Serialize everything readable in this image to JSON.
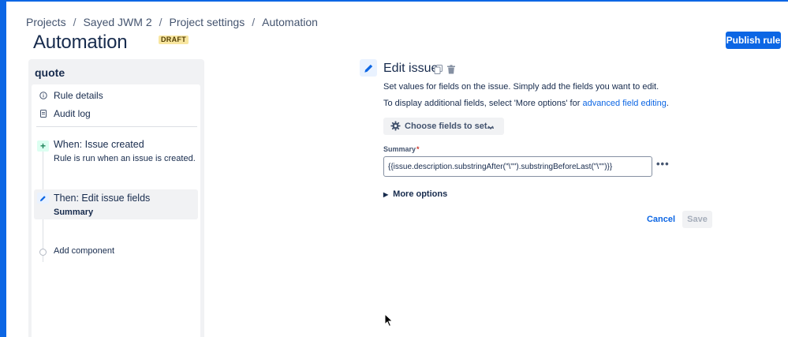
{
  "breadcrumb": [
    "Projects",
    "Sayed JWM 2",
    "Project settings",
    "Automation"
  ],
  "breadcrumb_separator": "/",
  "page": {
    "title": "Automation",
    "badge": "DRAFT"
  },
  "header": {
    "publish_label": "Publish rule"
  },
  "rule": {
    "name": "quote",
    "nav": {
      "details_label": "Rule details",
      "audit_label": "Audit log"
    },
    "trigger": {
      "title": "When: Issue created",
      "description": "Rule is run when an issue is created.",
      "icon_glyph": "+"
    },
    "action": {
      "title": "Then: Edit issue fields",
      "subtitle": "Summary"
    },
    "add_label": "Add component"
  },
  "editor": {
    "title": "Edit issue",
    "description": "Set values for fields on the issue. Simply add the fields you want to edit.",
    "additional_prefix": "To display additional fields, select 'More options' for ",
    "additional_link": "advanced field editing",
    "additional_suffix": ".",
    "choose_label": "Choose fields to set...",
    "field_label": "Summary",
    "required_marker": "*",
    "field_value": "{{issue.description.substringAfter(\"\\\"\").substringBeforeLast(\"\\\"\")}}",
    "field_menu_glyph": "•••",
    "more_options_label": "More options",
    "more_options_caret": "▶",
    "cancel_label": "Cancel",
    "save_label": "Save"
  },
  "colors": {
    "accent": "#0c66e4",
    "badge_bg": "#f8e6a0",
    "trigger_green": "#1f845a",
    "required_red": "#c9372c"
  },
  "icons": [
    "info-icon",
    "document-icon",
    "plus-icon",
    "pencil-icon",
    "copy-icon",
    "trash-icon",
    "gear-icon",
    "chevron-down-icon",
    "more-icon",
    "caret-right-icon",
    "mouse-cursor-icon"
  ]
}
